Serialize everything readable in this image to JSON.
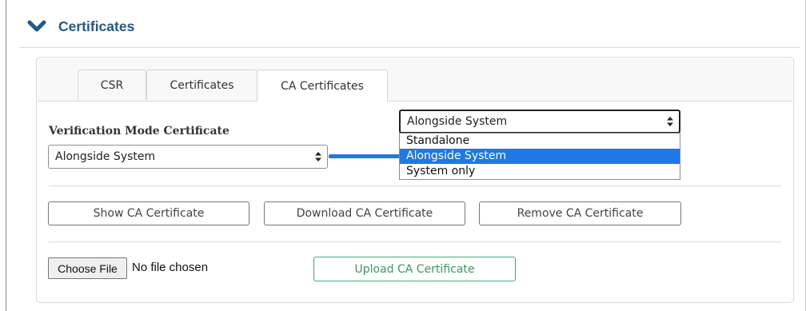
{
  "section": {
    "title": "Certificates",
    "toggle_icon": "chevron-down-icon",
    "accent_color": "#1d5a8e"
  },
  "tabs": [
    {
      "label": "CSR",
      "active": false
    },
    {
      "label": "Certificates",
      "active": false
    },
    {
      "label": "CA Certificates",
      "active": true
    }
  ],
  "verification": {
    "label": "Verification Mode Certificate",
    "selected": "Alongside System"
  },
  "open_select": {
    "selected": "Alongside System",
    "options": [
      "Standalone",
      "Alongside System",
      "System only"
    ],
    "highlighted_index": 1,
    "highlight_color": "#1e78e6"
  },
  "actions": {
    "show": "Show CA Certificate",
    "download": "Download CA Certificate",
    "remove": "Remove CA Certificate"
  },
  "upload": {
    "choose_label": "Choose File",
    "status": "No file chosen",
    "upload_label": "Upload CA Certificate",
    "upload_color": "#3cb371"
  }
}
